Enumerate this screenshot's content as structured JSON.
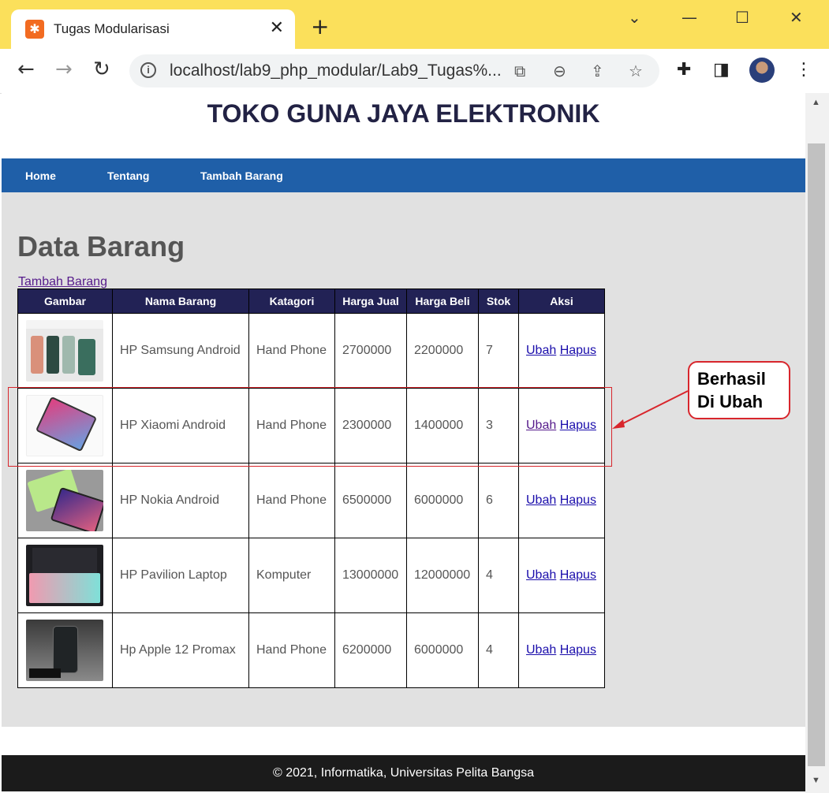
{
  "browser": {
    "tab_title": "Tugas Modularisasi",
    "url": "localhost/lab9_php_modular/Lab9_Tugas%..."
  },
  "site": {
    "title": "TOKO GUNA JAYA ELEKTRONIK",
    "nav": [
      "Home",
      "Tentang",
      "Tambah Barang"
    ],
    "nav_color": "#1f5fa8",
    "footer": "© 2021, Informatika, Universitas Pelita Bangsa"
  },
  "main": {
    "heading": "Data Barang",
    "add_link": "Tambah Barang",
    "columns": [
      "Gambar",
      "Nama Barang",
      "Katagori",
      "Harga Jual",
      "Harga Beli",
      "Stok",
      "Aksi"
    ],
    "action_edit": "Ubah",
    "action_delete": "Hapus",
    "rows": [
      {
        "image": "phone-image-icon",
        "name": "HP Samsung Android",
        "category": "Hand Phone",
        "sell": "2700000",
        "buy": "2200000",
        "stock": "7"
      },
      {
        "image": "phone-image-icon",
        "name": "HP Xiaomi Android",
        "category": "Hand Phone",
        "sell": "2300000",
        "buy": "1400000",
        "stock": "3"
      },
      {
        "image": "phone-image-icon",
        "name": "HP Nokia Android",
        "category": "Hand Phone",
        "sell": "6500000",
        "buy": "6000000",
        "stock": "6"
      },
      {
        "image": "laptop-image-icon",
        "name": "HP Pavilion Laptop",
        "category": "Komputer",
        "sell": "13000000",
        "buy": "12000000",
        "stock": "4"
      },
      {
        "image": "phone-image-icon",
        "name": "Hp Apple 12 Promax",
        "category": "Hand Phone",
        "sell": "6200000",
        "buy": "6000000",
        "stock": "4"
      }
    ]
  },
  "annotation": {
    "line1": "Berhasil",
    "line2": "Di Ubah",
    "color": "#d8262c"
  }
}
